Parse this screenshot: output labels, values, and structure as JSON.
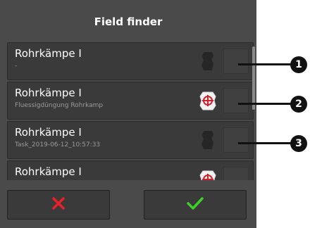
{
  "dialog": {
    "title": "Field finder"
  },
  "fields": [
    {
      "name": "Rohrkämpe I",
      "subtitle": "-",
      "icon": "field-shape-icon",
      "has_map_marker": false
    },
    {
      "name": "Rohrkämpe I",
      "subtitle": "Fluessigdüngung Rohrkamp",
      "icon": "field-target-icon",
      "has_map_marker": true
    },
    {
      "name": "Rohrkämpe I",
      "subtitle": "Task_2019-06-12_10:57:33",
      "icon": "field-shape-icon",
      "has_map_marker": false
    },
    {
      "name": "Rohrkämpe I",
      "subtitle": "",
      "icon": "field-target-icon",
      "has_map_marker": true
    }
  ],
  "buttons": {
    "cancel_icon": "x-icon",
    "confirm_icon": "checkmark-icon",
    "cancel_color": "#e8202a",
    "confirm_color": "#3ecf2a"
  },
  "callouts": [
    "1",
    "2",
    "3"
  ]
}
